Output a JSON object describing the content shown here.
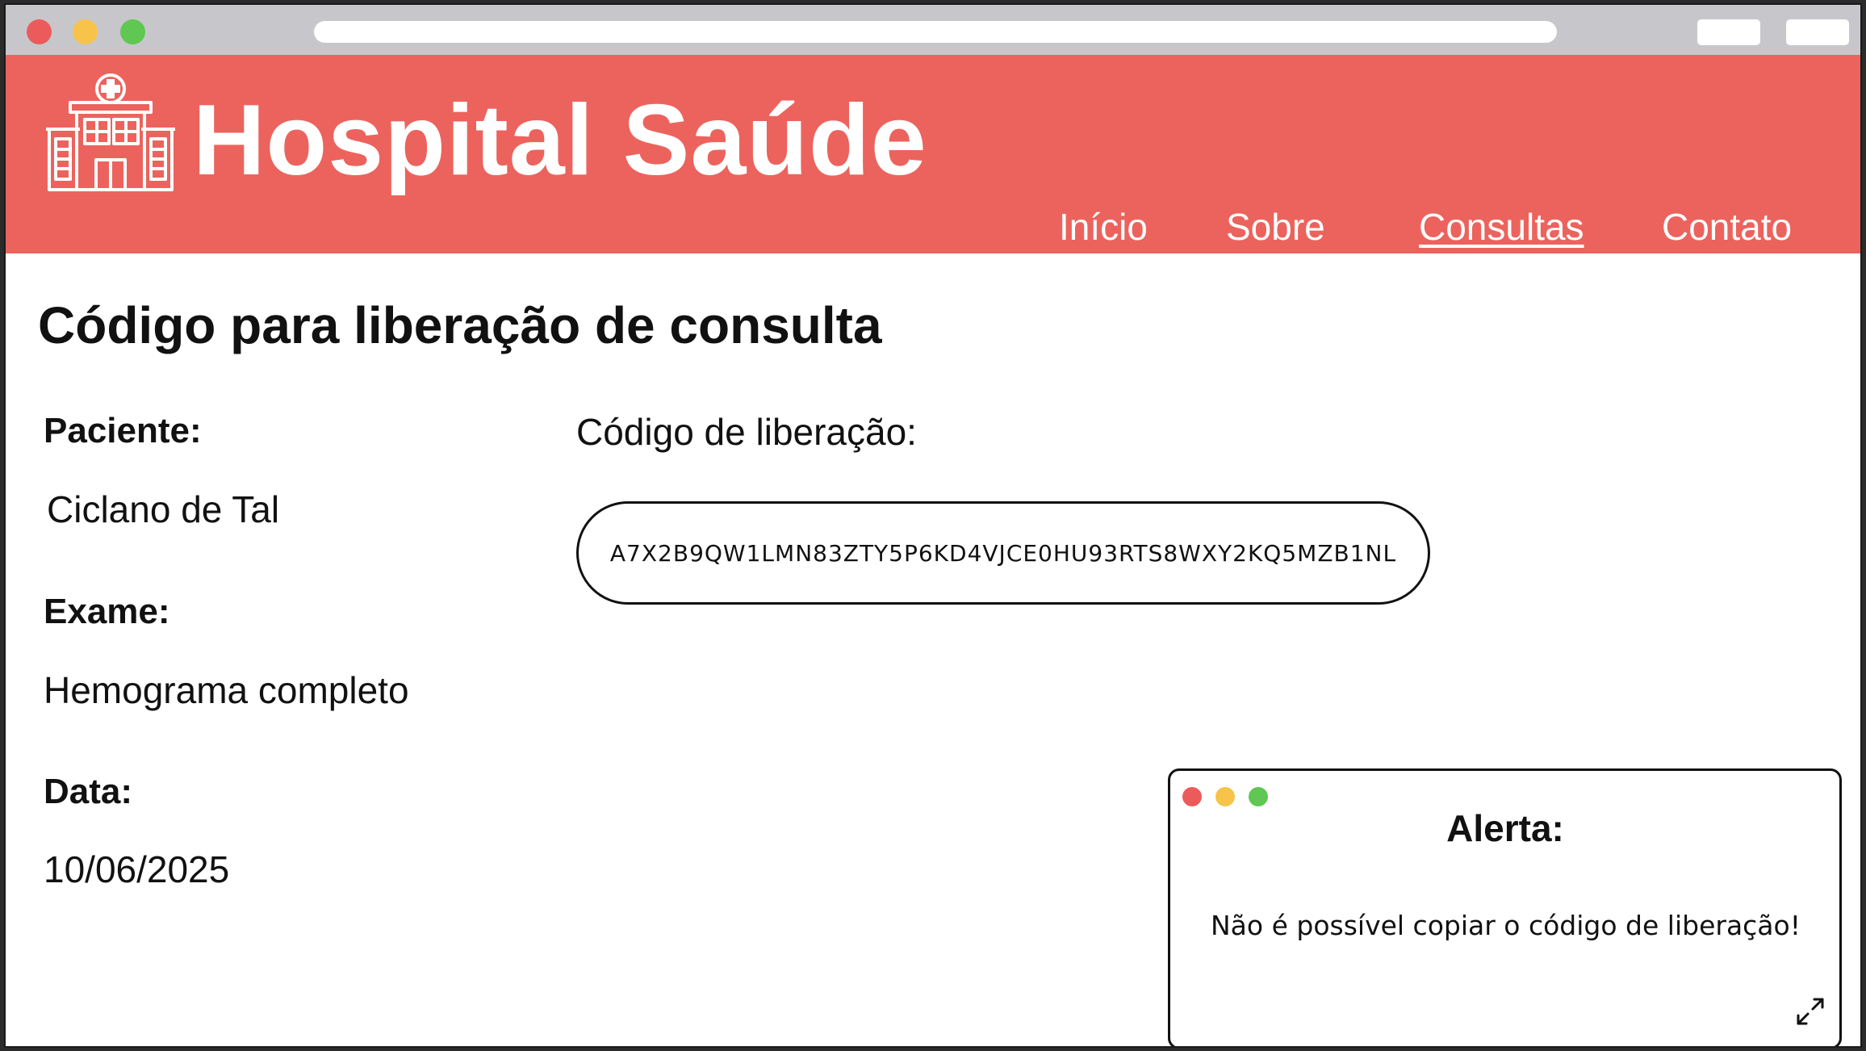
{
  "header": {
    "brand": "Hospital Saúde",
    "nav": [
      {
        "label": "Início",
        "active": false
      },
      {
        "label": "Sobre",
        "active": false
      },
      {
        "label": "Consultas",
        "active": true
      },
      {
        "label": "Contato",
        "active": false
      }
    ]
  },
  "page": {
    "title": "Código para liberação de consulta"
  },
  "patient": {
    "label": "Paciente:",
    "value": "Ciclano de Tal"
  },
  "exam": {
    "label": "Exame:",
    "value": "Hemograma completo"
  },
  "date": {
    "label": "Data:",
    "value": "10/06/2025"
  },
  "release": {
    "label": "Código de liberação:",
    "code": "A7X2B9QW1LMN83ZTY5P6KD4VJCE0HU93RTS8WXY2KQ5MZB1NL"
  },
  "alert": {
    "title": "Alerta:",
    "message": "Não é possível copiar o código de liberação!"
  },
  "colors": {
    "header_bg": "#ec635d",
    "chrome_bg": "#c7c7cb",
    "text": "#111111"
  },
  "icons": {
    "logo": "hospital-building-icon",
    "expand": "expand-arrows-icon"
  }
}
